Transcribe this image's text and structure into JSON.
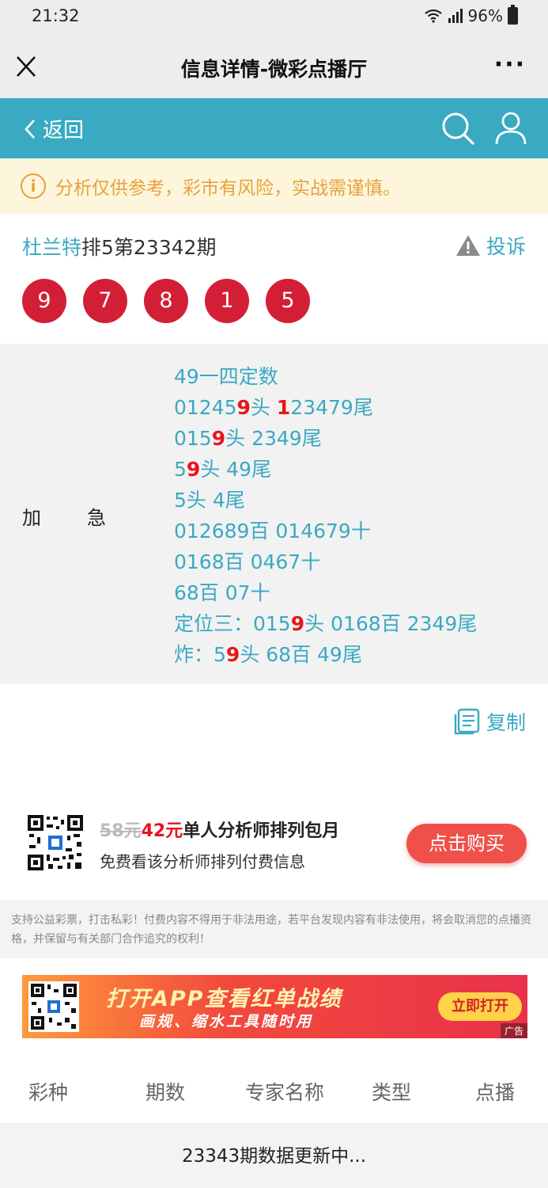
{
  "status_bar": {
    "time": "21:32",
    "battery": "96%"
  },
  "title_bar": {
    "title": "信息详情-微彩点播厅",
    "more": "···"
  },
  "nav": {
    "back_label": "返回"
  },
  "warning": {
    "text": "分析仅供参考，彩市有风险，实战需谨慎。",
    "icon": "i"
  },
  "issue": {
    "expert": "杜兰特",
    "desc": "排5第23342期",
    "complain_label": "投诉",
    "numbers": [
      "9",
      "7",
      "8",
      "1",
      "5"
    ]
  },
  "content": {
    "label_1": "加",
    "label_2": "急",
    "lines": [
      [
        {
          "t": "49一四定数"
        }
      ],
      [
        {
          "t": "01245"
        },
        {
          "t": "9",
          "r": true
        },
        {
          "t": "头 "
        },
        {
          "t": "1",
          "r": true
        },
        {
          "t": "23479尾"
        }
      ],
      [
        {
          "t": "015"
        },
        {
          "t": "9",
          "r": true
        },
        {
          "t": "头 2349尾"
        }
      ],
      [
        {
          "t": "5"
        },
        {
          "t": "9",
          "r": true
        },
        {
          "t": "头 49尾"
        }
      ],
      [
        {
          "t": "5头 4尾"
        }
      ],
      [
        {
          "t": "012689百 014679十"
        }
      ],
      [
        {
          "t": "0168百 0467十"
        }
      ],
      [
        {
          "t": "68百 07十"
        }
      ],
      [
        {
          "t": "定位三：015"
        },
        {
          "t": "9",
          "r": true
        },
        {
          "t": "头 0168百 2349尾"
        }
      ],
      [
        {
          "t": "炸：5"
        },
        {
          "t": "9",
          "r": true
        },
        {
          "t": "头 68百 49尾"
        }
      ]
    ]
  },
  "copy_label": "复制",
  "subscription": {
    "price_old": "58元",
    "price_new": "42元",
    "title_rest": "单人分析师排列包月",
    "desc": "免费看该分析师排列付费信息",
    "buy_label": "点击购买"
  },
  "disclaimer": "支持公益彩票，打击私彩！付费内容不得用于非法用途，若平台发现内容有非法使用，将会取消您的点播资格，并保留与有关部门合作追究的权利！",
  "banner": {
    "main": "打开APP查看红单战绩",
    "sub": "画规、缩水工具随时用",
    "button": "立即打开",
    "ad": "广告"
  },
  "table": {
    "headers": [
      "彩种",
      "期数",
      "专家名称",
      "类型",
      "点播"
    ],
    "update_text": "23343期数据更新中..."
  },
  "colors": {
    "accent": "#3aa9c2",
    "ball": "#d31f36",
    "highlight": "#e8141c",
    "warning": "#e6a23c"
  }
}
